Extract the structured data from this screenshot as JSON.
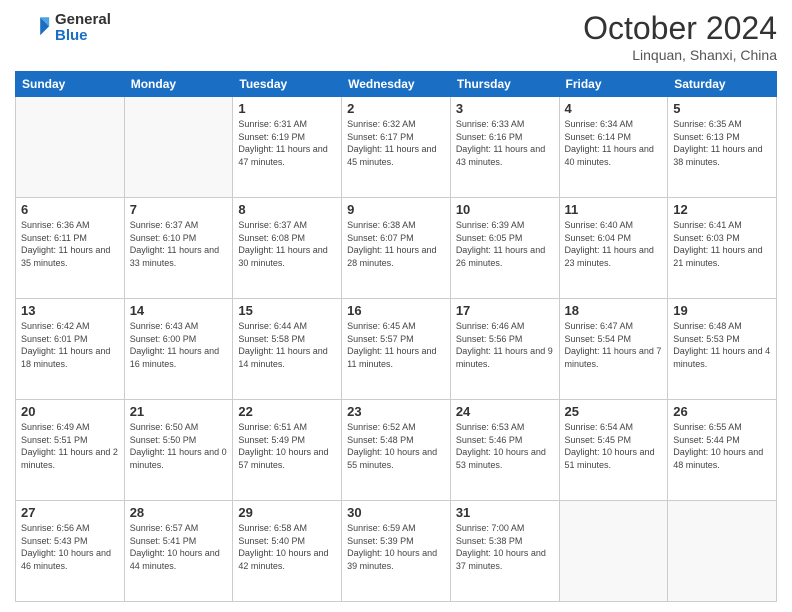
{
  "header": {
    "logo_general": "General",
    "logo_blue": "Blue",
    "month_title": "October 2024",
    "location": "Linquan, Shanxi, China"
  },
  "weekdays": [
    "Sunday",
    "Monday",
    "Tuesday",
    "Wednesday",
    "Thursday",
    "Friday",
    "Saturday"
  ],
  "weeks": [
    [
      {
        "day": "",
        "sunrise": "",
        "sunset": "",
        "daylight": ""
      },
      {
        "day": "",
        "sunrise": "",
        "sunset": "",
        "daylight": ""
      },
      {
        "day": "1",
        "sunrise": "Sunrise: 6:31 AM",
        "sunset": "Sunset: 6:19 PM",
        "daylight": "Daylight: 11 hours and 47 minutes."
      },
      {
        "day": "2",
        "sunrise": "Sunrise: 6:32 AM",
        "sunset": "Sunset: 6:17 PM",
        "daylight": "Daylight: 11 hours and 45 minutes."
      },
      {
        "day": "3",
        "sunrise": "Sunrise: 6:33 AM",
        "sunset": "Sunset: 6:16 PM",
        "daylight": "Daylight: 11 hours and 43 minutes."
      },
      {
        "day": "4",
        "sunrise": "Sunrise: 6:34 AM",
        "sunset": "Sunset: 6:14 PM",
        "daylight": "Daylight: 11 hours and 40 minutes."
      },
      {
        "day": "5",
        "sunrise": "Sunrise: 6:35 AM",
        "sunset": "Sunset: 6:13 PM",
        "daylight": "Daylight: 11 hours and 38 minutes."
      }
    ],
    [
      {
        "day": "6",
        "sunrise": "Sunrise: 6:36 AM",
        "sunset": "Sunset: 6:11 PM",
        "daylight": "Daylight: 11 hours and 35 minutes."
      },
      {
        "day": "7",
        "sunrise": "Sunrise: 6:37 AM",
        "sunset": "Sunset: 6:10 PM",
        "daylight": "Daylight: 11 hours and 33 minutes."
      },
      {
        "day": "8",
        "sunrise": "Sunrise: 6:37 AM",
        "sunset": "Sunset: 6:08 PM",
        "daylight": "Daylight: 11 hours and 30 minutes."
      },
      {
        "day": "9",
        "sunrise": "Sunrise: 6:38 AM",
        "sunset": "Sunset: 6:07 PM",
        "daylight": "Daylight: 11 hours and 28 minutes."
      },
      {
        "day": "10",
        "sunrise": "Sunrise: 6:39 AM",
        "sunset": "Sunset: 6:05 PM",
        "daylight": "Daylight: 11 hours and 26 minutes."
      },
      {
        "day": "11",
        "sunrise": "Sunrise: 6:40 AM",
        "sunset": "Sunset: 6:04 PM",
        "daylight": "Daylight: 11 hours and 23 minutes."
      },
      {
        "day": "12",
        "sunrise": "Sunrise: 6:41 AM",
        "sunset": "Sunset: 6:03 PM",
        "daylight": "Daylight: 11 hours and 21 minutes."
      }
    ],
    [
      {
        "day": "13",
        "sunrise": "Sunrise: 6:42 AM",
        "sunset": "Sunset: 6:01 PM",
        "daylight": "Daylight: 11 hours and 18 minutes."
      },
      {
        "day": "14",
        "sunrise": "Sunrise: 6:43 AM",
        "sunset": "Sunset: 6:00 PM",
        "daylight": "Daylight: 11 hours and 16 minutes."
      },
      {
        "day": "15",
        "sunrise": "Sunrise: 6:44 AM",
        "sunset": "Sunset: 5:58 PM",
        "daylight": "Daylight: 11 hours and 14 minutes."
      },
      {
        "day": "16",
        "sunrise": "Sunrise: 6:45 AM",
        "sunset": "Sunset: 5:57 PM",
        "daylight": "Daylight: 11 hours and 11 minutes."
      },
      {
        "day": "17",
        "sunrise": "Sunrise: 6:46 AM",
        "sunset": "Sunset: 5:56 PM",
        "daylight": "Daylight: 11 hours and 9 minutes."
      },
      {
        "day": "18",
        "sunrise": "Sunrise: 6:47 AM",
        "sunset": "Sunset: 5:54 PM",
        "daylight": "Daylight: 11 hours and 7 minutes."
      },
      {
        "day": "19",
        "sunrise": "Sunrise: 6:48 AM",
        "sunset": "Sunset: 5:53 PM",
        "daylight": "Daylight: 11 hours and 4 minutes."
      }
    ],
    [
      {
        "day": "20",
        "sunrise": "Sunrise: 6:49 AM",
        "sunset": "Sunset: 5:51 PM",
        "daylight": "Daylight: 11 hours and 2 minutes."
      },
      {
        "day": "21",
        "sunrise": "Sunrise: 6:50 AM",
        "sunset": "Sunset: 5:50 PM",
        "daylight": "Daylight: 11 hours and 0 minutes."
      },
      {
        "day": "22",
        "sunrise": "Sunrise: 6:51 AM",
        "sunset": "Sunset: 5:49 PM",
        "daylight": "Daylight: 10 hours and 57 minutes."
      },
      {
        "day": "23",
        "sunrise": "Sunrise: 6:52 AM",
        "sunset": "Sunset: 5:48 PM",
        "daylight": "Daylight: 10 hours and 55 minutes."
      },
      {
        "day": "24",
        "sunrise": "Sunrise: 6:53 AM",
        "sunset": "Sunset: 5:46 PM",
        "daylight": "Daylight: 10 hours and 53 minutes."
      },
      {
        "day": "25",
        "sunrise": "Sunrise: 6:54 AM",
        "sunset": "Sunset: 5:45 PM",
        "daylight": "Daylight: 10 hours and 51 minutes."
      },
      {
        "day": "26",
        "sunrise": "Sunrise: 6:55 AM",
        "sunset": "Sunset: 5:44 PM",
        "daylight": "Daylight: 10 hours and 48 minutes."
      }
    ],
    [
      {
        "day": "27",
        "sunrise": "Sunrise: 6:56 AM",
        "sunset": "Sunset: 5:43 PM",
        "daylight": "Daylight: 10 hours and 46 minutes."
      },
      {
        "day": "28",
        "sunrise": "Sunrise: 6:57 AM",
        "sunset": "Sunset: 5:41 PM",
        "daylight": "Daylight: 10 hours and 44 minutes."
      },
      {
        "day": "29",
        "sunrise": "Sunrise: 6:58 AM",
        "sunset": "Sunset: 5:40 PM",
        "daylight": "Daylight: 10 hours and 42 minutes."
      },
      {
        "day": "30",
        "sunrise": "Sunrise: 6:59 AM",
        "sunset": "Sunset: 5:39 PM",
        "daylight": "Daylight: 10 hours and 39 minutes."
      },
      {
        "day": "31",
        "sunrise": "Sunrise: 7:00 AM",
        "sunset": "Sunset: 5:38 PM",
        "daylight": "Daylight: 10 hours and 37 minutes."
      },
      {
        "day": "",
        "sunrise": "",
        "sunset": "",
        "daylight": ""
      },
      {
        "day": "",
        "sunrise": "",
        "sunset": "",
        "daylight": ""
      }
    ]
  ]
}
